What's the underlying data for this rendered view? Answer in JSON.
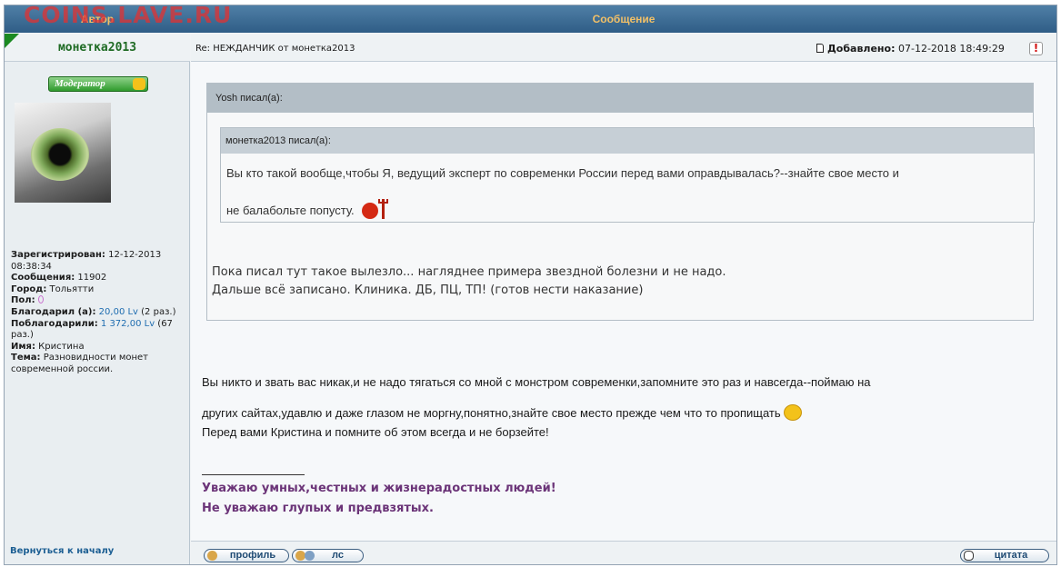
{
  "watermark": "COINS.LAVE.RU",
  "header": {
    "author_col": "Автор",
    "message_col": "Сообщение"
  },
  "author": {
    "name": "монетка2013",
    "badge": "Модератор",
    "registered_label": "Зарегистрирован:",
    "registered_value": "12-12-2013 08:38:34",
    "messages_label": "Сообщения:",
    "messages_value": "11902",
    "city_label": "Город:",
    "city_value": "Тольятти",
    "gender_label": "Пол:",
    "thanked_label": "Благодарил (а):",
    "thanked_value": "20,00 Lv",
    "thanked_count": "(2 раз.)",
    "got_thanks_label": "Поблагодарили:",
    "got_thanks_value": "1 372,00 Lv",
    "got_thanks_count": "(67 раз.)",
    "name_label": "Имя:",
    "name_value": "Кристина",
    "topic_label": "Тема:",
    "topic_value": "Разновидности монет современной россии."
  },
  "back_link": "Вернуться к началу",
  "message": {
    "subject": "Re: НЕЖДАНЧИК от монетка2013",
    "posted_label": "Добавлено:",
    "posted_value": "07-12-2018 18:49:29",
    "quote_outer_author": "Yosh писал(а):",
    "quote_inner_author": "монетка2013 писал(а):",
    "quote_inner_line1": "Вы кто такой вообще,чтобы Я, ведущий эксперт по современки России перед вами оправдывалась?--знайте свое место и",
    "quote_inner_line2": "не балабольте попусту.",
    "quote_outer_line1": "Пока писал тут такое вылезло... нагляднее примера звездной болезни и не надо.",
    "quote_outer_line2": "Дальше всё записано. Клиника. ДБ, ПЦ, ТП! (готов нести наказание)",
    "body_line1": "Вы никто и звать вас никак,и не надо тягаться со мной с монстром современки,запомните это раз и навсегда--поймаю на",
    "body_line2": "других сайтах,удавлю и даже глазом не моргну,понятно,знайте свое место прежде чем что то пропищать",
    "body_line3": "Перед вами Кристина и помните об этом всегда и не борзейте!",
    "signature_line1": "Уважаю умных,честных и жизнерадостных людей!",
    "signature_line2": "Не уважаю глупых и предвзятых."
  },
  "buttons": {
    "profile": "профиль",
    "pm": "лс",
    "quote": "цитата"
  },
  "colors": {
    "header_bg": "#2f5d86",
    "header_text": "#f2c067",
    "signature": "#6b3478",
    "author_name": "#1f6b24"
  }
}
